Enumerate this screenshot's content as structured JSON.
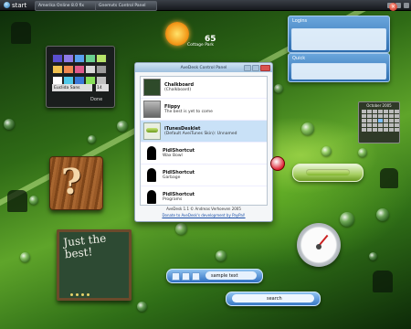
{
  "taskbar": {
    "start_label": "start",
    "tasks": [
      "Amerika Online 8.0 fix",
      "Gnemvts Control Panel"
    ]
  },
  "palette": {
    "swatch_colors": [
      "#5a4fd1",
      "#8f7be8",
      "#59a0f0",
      "#6ad08f",
      "#b7e36a",
      "#f0c24f",
      "#f0884f",
      "#e05a8c",
      "#d8d8d8",
      "#9c9c9c",
      "#ffffff",
      "#50c8e8",
      "#3b78d8",
      "#88e05a",
      "#c0c0c0"
    ],
    "font": "Euclida Sans",
    "size": "14",
    "done_label": "Done"
  },
  "weather": {
    "temperature": "65",
    "location": "Cottage Park"
  },
  "window": {
    "title": "AveDesk Control Panel",
    "items": [
      {
        "icon": "chalkboard-thumbnail",
        "name": "Chalkboard",
        "detail": "(Chalkboard)",
        "selected": false
      },
      {
        "icon": "flippy-thumbnail",
        "name": "Flippy",
        "detail": "The best is yet to come",
        "selected": false
      },
      {
        "icon": "itunes-thumbnail",
        "name": "iTunesDesklet",
        "detail": "(Default AveiTunes Skin): Unnamed",
        "selected": true
      },
      {
        "icon": "recycle-thumbnail",
        "name": "PidlShortcut",
        "detail": "Wax Bowl",
        "selected": false
      },
      {
        "icon": "recycle-thumbnail",
        "name": "PidlShortcut",
        "detail": "Garbage",
        "selected": false
      },
      {
        "icon": "recycle-thumbnail",
        "name": "PidlShortcut",
        "detail": "Programs",
        "selected": false
      }
    ],
    "footer_credit": "AveDesk 1.1 © Andreas Verhoeven 2005",
    "footer_link": "Donate to AveDesk's development by PayPal!"
  },
  "notes": {
    "top_label": "Logins",
    "bottom_label": "Quick"
  },
  "calendar": {
    "header": "October 2005"
  },
  "chalkboard": {
    "text": "Just the best!"
  },
  "wood_tile": {
    "glyph": "?"
  },
  "textbar": {
    "value": "sample text"
  },
  "search": {
    "placeholder": "search"
  }
}
